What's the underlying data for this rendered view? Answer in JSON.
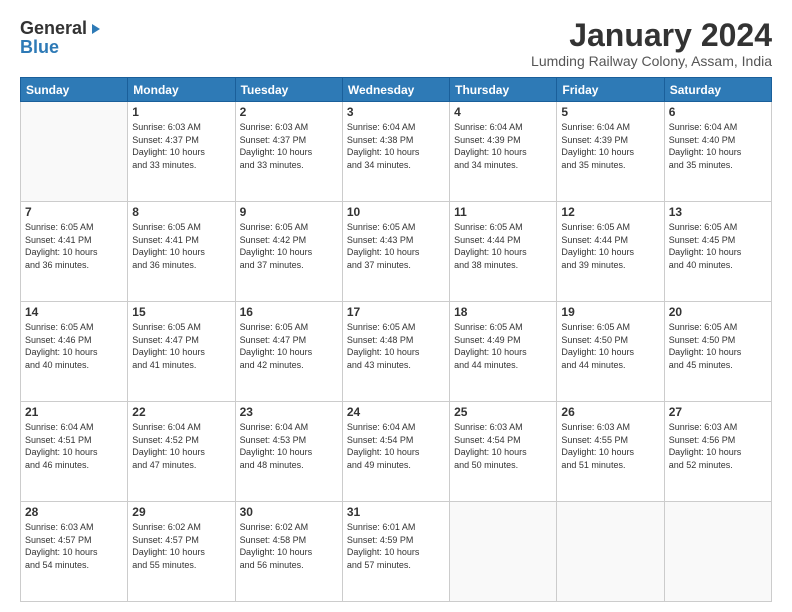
{
  "logo": {
    "general": "General",
    "blue": "Blue"
  },
  "title": {
    "month": "January 2024",
    "location": "Lumding Railway Colony, Assam, India"
  },
  "days_of_week": [
    "Sunday",
    "Monday",
    "Tuesday",
    "Wednesday",
    "Thursday",
    "Friday",
    "Saturday"
  ],
  "weeks": [
    [
      {
        "day": "",
        "content": ""
      },
      {
        "day": "1",
        "content": "Sunrise: 6:03 AM\nSunset: 4:37 PM\nDaylight: 10 hours\nand 33 minutes."
      },
      {
        "day": "2",
        "content": "Sunrise: 6:03 AM\nSunset: 4:37 PM\nDaylight: 10 hours\nand 33 minutes."
      },
      {
        "day": "3",
        "content": "Sunrise: 6:04 AM\nSunset: 4:38 PM\nDaylight: 10 hours\nand 34 minutes."
      },
      {
        "day": "4",
        "content": "Sunrise: 6:04 AM\nSunset: 4:39 PM\nDaylight: 10 hours\nand 34 minutes."
      },
      {
        "day": "5",
        "content": "Sunrise: 6:04 AM\nSunset: 4:39 PM\nDaylight: 10 hours\nand 35 minutes."
      },
      {
        "day": "6",
        "content": "Sunrise: 6:04 AM\nSunset: 4:40 PM\nDaylight: 10 hours\nand 35 minutes."
      }
    ],
    [
      {
        "day": "7",
        "content": "Sunrise: 6:05 AM\nSunset: 4:41 PM\nDaylight: 10 hours\nand 36 minutes."
      },
      {
        "day": "8",
        "content": "Sunrise: 6:05 AM\nSunset: 4:41 PM\nDaylight: 10 hours\nand 36 minutes."
      },
      {
        "day": "9",
        "content": "Sunrise: 6:05 AM\nSunset: 4:42 PM\nDaylight: 10 hours\nand 37 minutes."
      },
      {
        "day": "10",
        "content": "Sunrise: 6:05 AM\nSunset: 4:43 PM\nDaylight: 10 hours\nand 37 minutes."
      },
      {
        "day": "11",
        "content": "Sunrise: 6:05 AM\nSunset: 4:44 PM\nDaylight: 10 hours\nand 38 minutes."
      },
      {
        "day": "12",
        "content": "Sunrise: 6:05 AM\nSunset: 4:44 PM\nDaylight: 10 hours\nand 39 minutes."
      },
      {
        "day": "13",
        "content": "Sunrise: 6:05 AM\nSunset: 4:45 PM\nDaylight: 10 hours\nand 40 minutes."
      }
    ],
    [
      {
        "day": "14",
        "content": "Sunrise: 6:05 AM\nSunset: 4:46 PM\nDaylight: 10 hours\nand 40 minutes."
      },
      {
        "day": "15",
        "content": "Sunrise: 6:05 AM\nSunset: 4:47 PM\nDaylight: 10 hours\nand 41 minutes."
      },
      {
        "day": "16",
        "content": "Sunrise: 6:05 AM\nSunset: 4:47 PM\nDaylight: 10 hours\nand 42 minutes."
      },
      {
        "day": "17",
        "content": "Sunrise: 6:05 AM\nSunset: 4:48 PM\nDaylight: 10 hours\nand 43 minutes."
      },
      {
        "day": "18",
        "content": "Sunrise: 6:05 AM\nSunset: 4:49 PM\nDaylight: 10 hours\nand 44 minutes."
      },
      {
        "day": "19",
        "content": "Sunrise: 6:05 AM\nSunset: 4:50 PM\nDaylight: 10 hours\nand 44 minutes."
      },
      {
        "day": "20",
        "content": "Sunrise: 6:05 AM\nSunset: 4:50 PM\nDaylight: 10 hours\nand 45 minutes."
      }
    ],
    [
      {
        "day": "21",
        "content": "Sunrise: 6:04 AM\nSunset: 4:51 PM\nDaylight: 10 hours\nand 46 minutes."
      },
      {
        "day": "22",
        "content": "Sunrise: 6:04 AM\nSunset: 4:52 PM\nDaylight: 10 hours\nand 47 minutes."
      },
      {
        "day": "23",
        "content": "Sunrise: 6:04 AM\nSunset: 4:53 PM\nDaylight: 10 hours\nand 48 minutes."
      },
      {
        "day": "24",
        "content": "Sunrise: 6:04 AM\nSunset: 4:54 PM\nDaylight: 10 hours\nand 49 minutes."
      },
      {
        "day": "25",
        "content": "Sunrise: 6:03 AM\nSunset: 4:54 PM\nDaylight: 10 hours\nand 50 minutes."
      },
      {
        "day": "26",
        "content": "Sunrise: 6:03 AM\nSunset: 4:55 PM\nDaylight: 10 hours\nand 51 minutes."
      },
      {
        "day": "27",
        "content": "Sunrise: 6:03 AM\nSunset: 4:56 PM\nDaylight: 10 hours\nand 52 minutes."
      }
    ],
    [
      {
        "day": "28",
        "content": "Sunrise: 6:03 AM\nSunset: 4:57 PM\nDaylight: 10 hours\nand 54 minutes."
      },
      {
        "day": "29",
        "content": "Sunrise: 6:02 AM\nSunset: 4:57 PM\nDaylight: 10 hours\nand 55 minutes."
      },
      {
        "day": "30",
        "content": "Sunrise: 6:02 AM\nSunset: 4:58 PM\nDaylight: 10 hours\nand 56 minutes."
      },
      {
        "day": "31",
        "content": "Sunrise: 6:01 AM\nSunset: 4:59 PM\nDaylight: 10 hours\nand 57 minutes."
      },
      {
        "day": "",
        "content": ""
      },
      {
        "day": "",
        "content": ""
      },
      {
        "day": "",
        "content": ""
      }
    ]
  ]
}
